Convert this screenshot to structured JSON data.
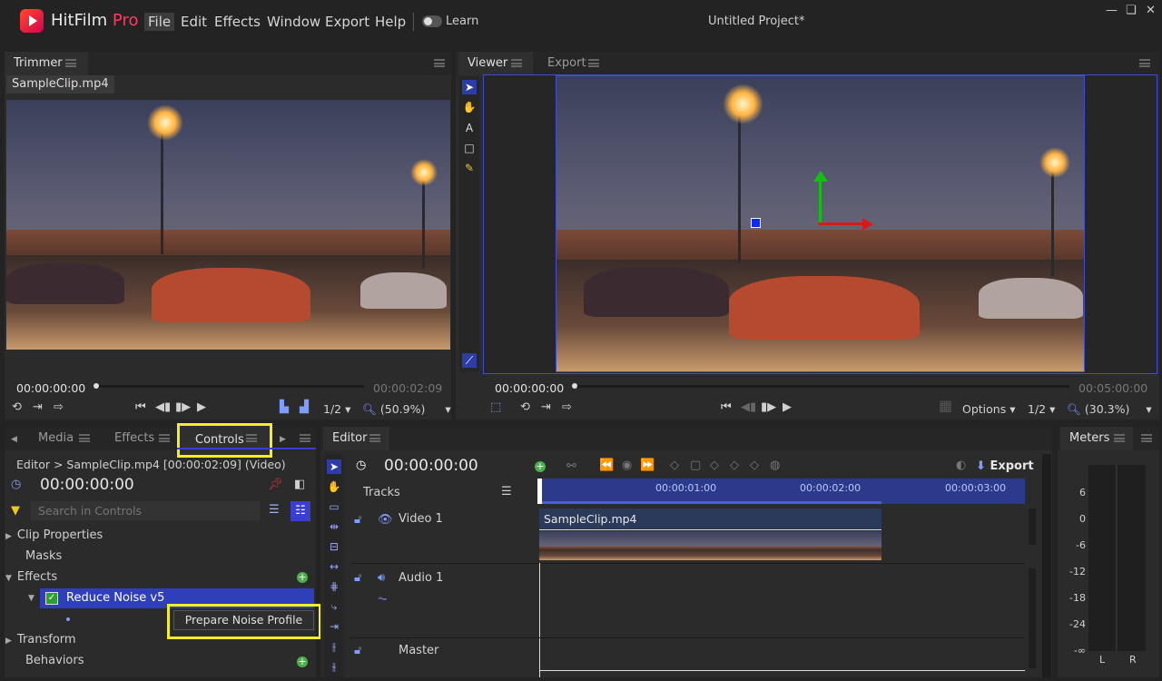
{
  "app": {
    "brand_main": "HitFilm",
    "brand_suffix": "Pro",
    "project_title": "Untitled Project*",
    "learn_label": "Learn"
  },
  "menu": [
    "File",
    "Edit",
    "Effects",
    "Window",
    "Export",
    "Help"
  ],
  "window_buttons": [
    "—",
    "❏",
    "✕"
  ],
  "trimmer": {
    "tab": "Trimmer",
    "clip_tab": "SampleClip.mp4",
    "timecode": "00:00:00:00",
    "duration": "00:00:02:09",
    "resolution": "1/2",
    "zoom": "(50.9%)"
  },
  "viewer": {
    "tabs": [
      "Viewer",
      "Export"
    ],
    "timecode": "00:00:00:00",
    "duration": "00:05:00:00",
    "options_label": "Options",
    "resolution": "1/2",
    "zoom": "(30.3%)"
  },
  "lower_tabs": {
    "media": "Media",
    "effects": "Effects",
    "controls": "Controls"
  },
  "controls": {
    "breadcrumb": "Editor > SampleClip.mp4 [00:00:02:09] (Video)",
    "timecode": "00:00:00:00",
    "search_placeholder": "Search in Controls",
    "rows": {
      "clip_properties": "Clip Properties",
      "masks": "Masks",
      "effects": "Effects",
      "reduce_noise": "Reduce Noise v5",
      "prepare_button": "Prepare Noise Profile",
      "transform": "Transform",
      "behaviors": "Behaviors"
    }
  },
  "editor": {
    "tab": "Editor",
    "timecode": "00:00:00:00",
    "export_label": "Export",
    "tracks_label": "Tracks",
    "ruler": [
      "00:00:01:00",
      "00:00:02:00",
      "00:00:03:00"
    ],
    "tracks": {
      "video": "Video 1",
      "audio": "Audio 1",
      "master": "Master"
    },
    "clip_name": "SampleClip.mp4"
  },
  "meters": {
    "tab": "Meters",
    "scale": [
      "6",
      "0",
      "-6",
      "-12",
      "-18",
      "-24",
      "-∞"
    ],
    "channels": [
      "L",
      "R"
    ]
  },
  "colors": {
    "accent": "#3a3fd0",
    "highlight": "#f2ee2a",
    "brand": "#ff3a5c"
  }
}
